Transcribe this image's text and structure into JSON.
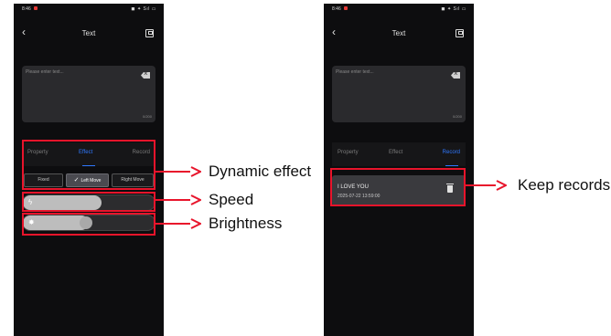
{
  "colors": {
    "accent": "#2f78ff",
    "highlight": "#e8142b",
    "phone_bg": "#0d0d0f"
  },
  "left_screen": {
    "status": {
      "time": "8:46",
      "system": "◼ ✦ Sıl ▭"
    },
    "nav": {
      "back_icon": "chevron-left-icon",
      "title": "Text",
      "save_icon": "save-icon"
    },
    "text_input": {
      "placeholder": "Please enter text...",
      "counter": "0/200"
    },
    "tabs": [
      "Property",
      "Effect",
      "Record"
    ],
    "active_tab": "Effect",
    "effects": [
      "Fixed",
      "Left Move",
      "Right Move"
    ],
    "selected_effect": "Left Move",
    "speed": {
      "icon": "lightning-icon",
      "level": 0.6
    },
    "brightness": {
      "icon": "sun-icon",
      "level": 0.5
    }
  },
  "right_screen": {
    "status": {
      "time": "8:46",
      "system": "◼ ✦ Sıl ▭"
    },
    "nav": {
      "back_icon": "chevron-left-icon",
      "title": "Text",
      "save_icon": "save-icon"
    },
    "text_input": {
      "placeholder": "Please enter text...",
      "counter": "0/200"
    },
    "tabs": [
      "Property",
      "Effect",
      "Record"
    ],
    "active_tab": "Record",
    "record": {
      "text": "I LOVE YOU",
      "date": "2025-07-22 13:59:00",
      "delete_icon": "trash-icon"
    }
  },
  "callouts": {
    "dynamic_effect": "Dynamic effect",
    "speed": "Speed",
    "brightness": "Brightness",
    "keep_records": "Keep records"
  }
}
